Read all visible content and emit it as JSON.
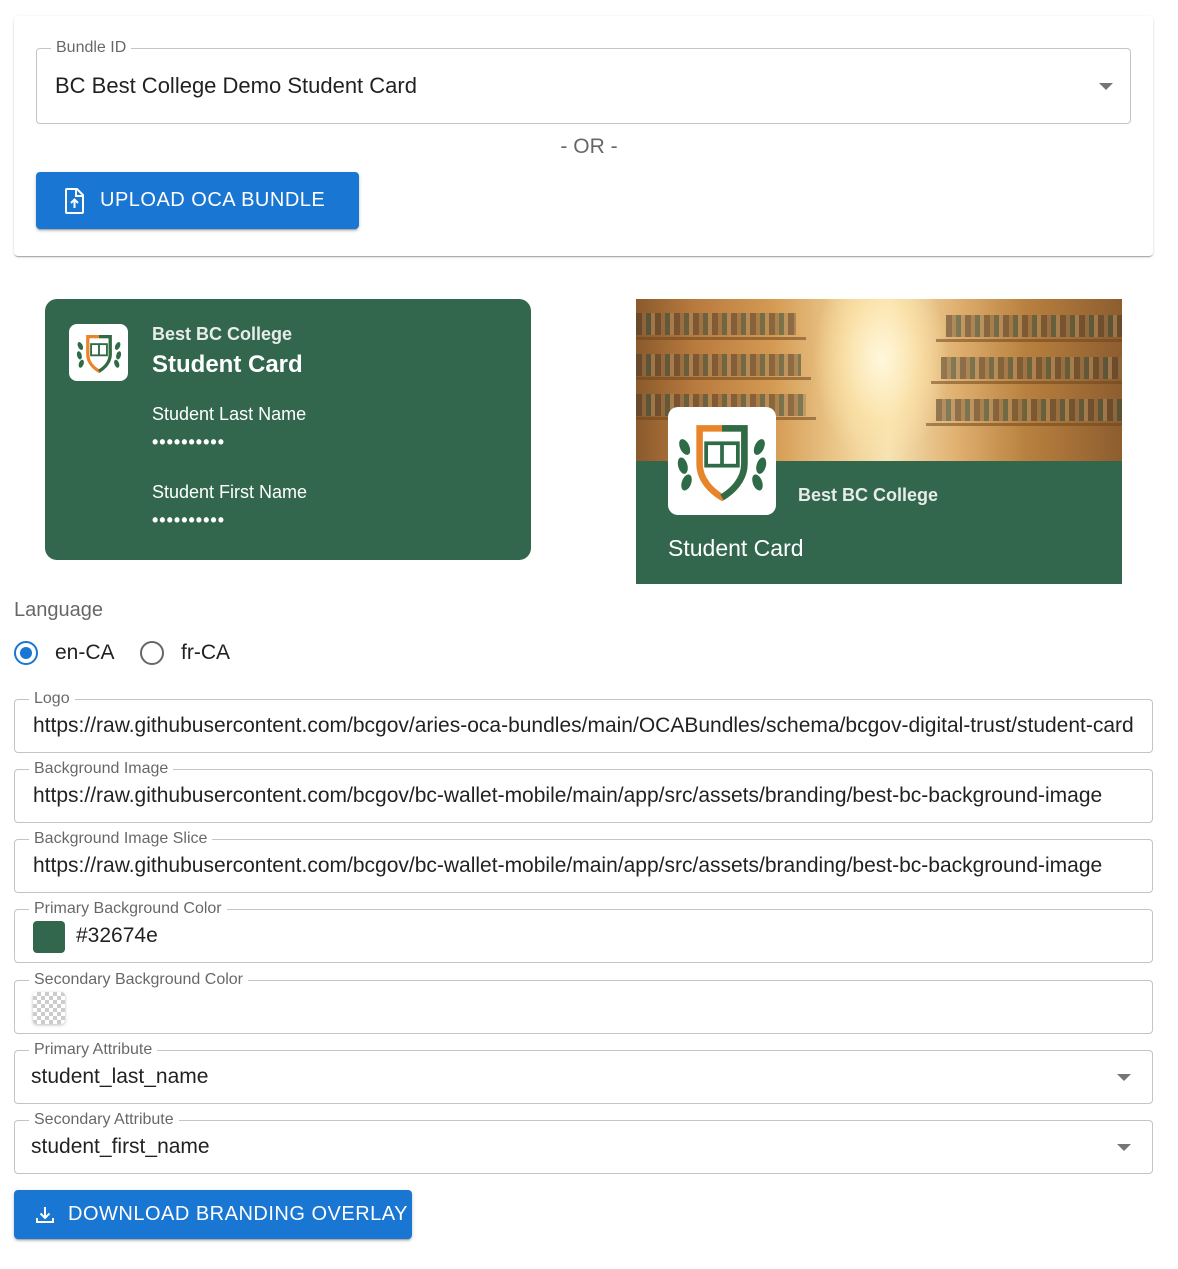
{
  "bundle": {
    "label": "Bundle ID",
    "value": "BC Best College Demo Student Card",
    "or_text": "- OR -",
    "upload_label": "UPLOAD OCA BUNDLE"
  },
  "card_front": {
    "issuer": "Best BC College",
    "name": "Student Card",
    "primary_label": "Student Last Name",
    "primary_value": "••••••••••",
    "secondary_label": "Student First Name",
    "secondary_value": "••••••••••"
  },
  "card_detail": {
    "issuer": "Best BC College",
    "name": "Student Card"
  },
  "language": {
    "label": "Language",
    "options": [
      "en-CA",
      "fr-CA"
    ],
    "selected": "en-CA"
  },
  "fields": {
    "logo": {
      "label": "Logo",
      "value": "https://raw.githubusercontent.com/bcgov/aries-oca-bundles/main/OCABundles/schema/bcgov-digital-trust/student-card"
    },
    "background_image": {
      "label": "Background Image",
      "value": "https://raw.githubusercontent.com/bcgov/bc-wallet-mobile/main/app/src/assets/branding/best-bc-background-image"
    },
    "background_image_slice": {
      "label": "Background Image Slice",
      "value": "https://raw.githubusercontent.com/bcgov/bc-wallet-mobile/main/app/src/assets/branding/best-bc-background-image"
    },
    "primary_bg_color": {
      "label": "Primary Background Color",
      "value": "#32674e"
    },
    "secondary_bg_color": {
      "label": "Secondary Background Color",
      "value": ""
    },
    "primary_attribute": {
      "label": "Primary Attribute",
      "value": "student_last_name"
    },
    "secondary_attribute": {
      "label": "Secondary Attribute",
      "value": "student_first_name"
    }
  },
  "download_label": "DOWNLOAD BRANDING OVERLAY",
  "colors": {
    "accent": "#1976d2",
    "card_primary": "#32674e",
    "logo_orange": "#e8852b",
    "logo_green": "#2f6b47"
  },
  "icons": {
    "upload": "upload-file-icon",
    "download": "download-icon",
    "dropdown": "arrow-drop-down-icon",
    "logo": "college-shield-logo"
  }
}
